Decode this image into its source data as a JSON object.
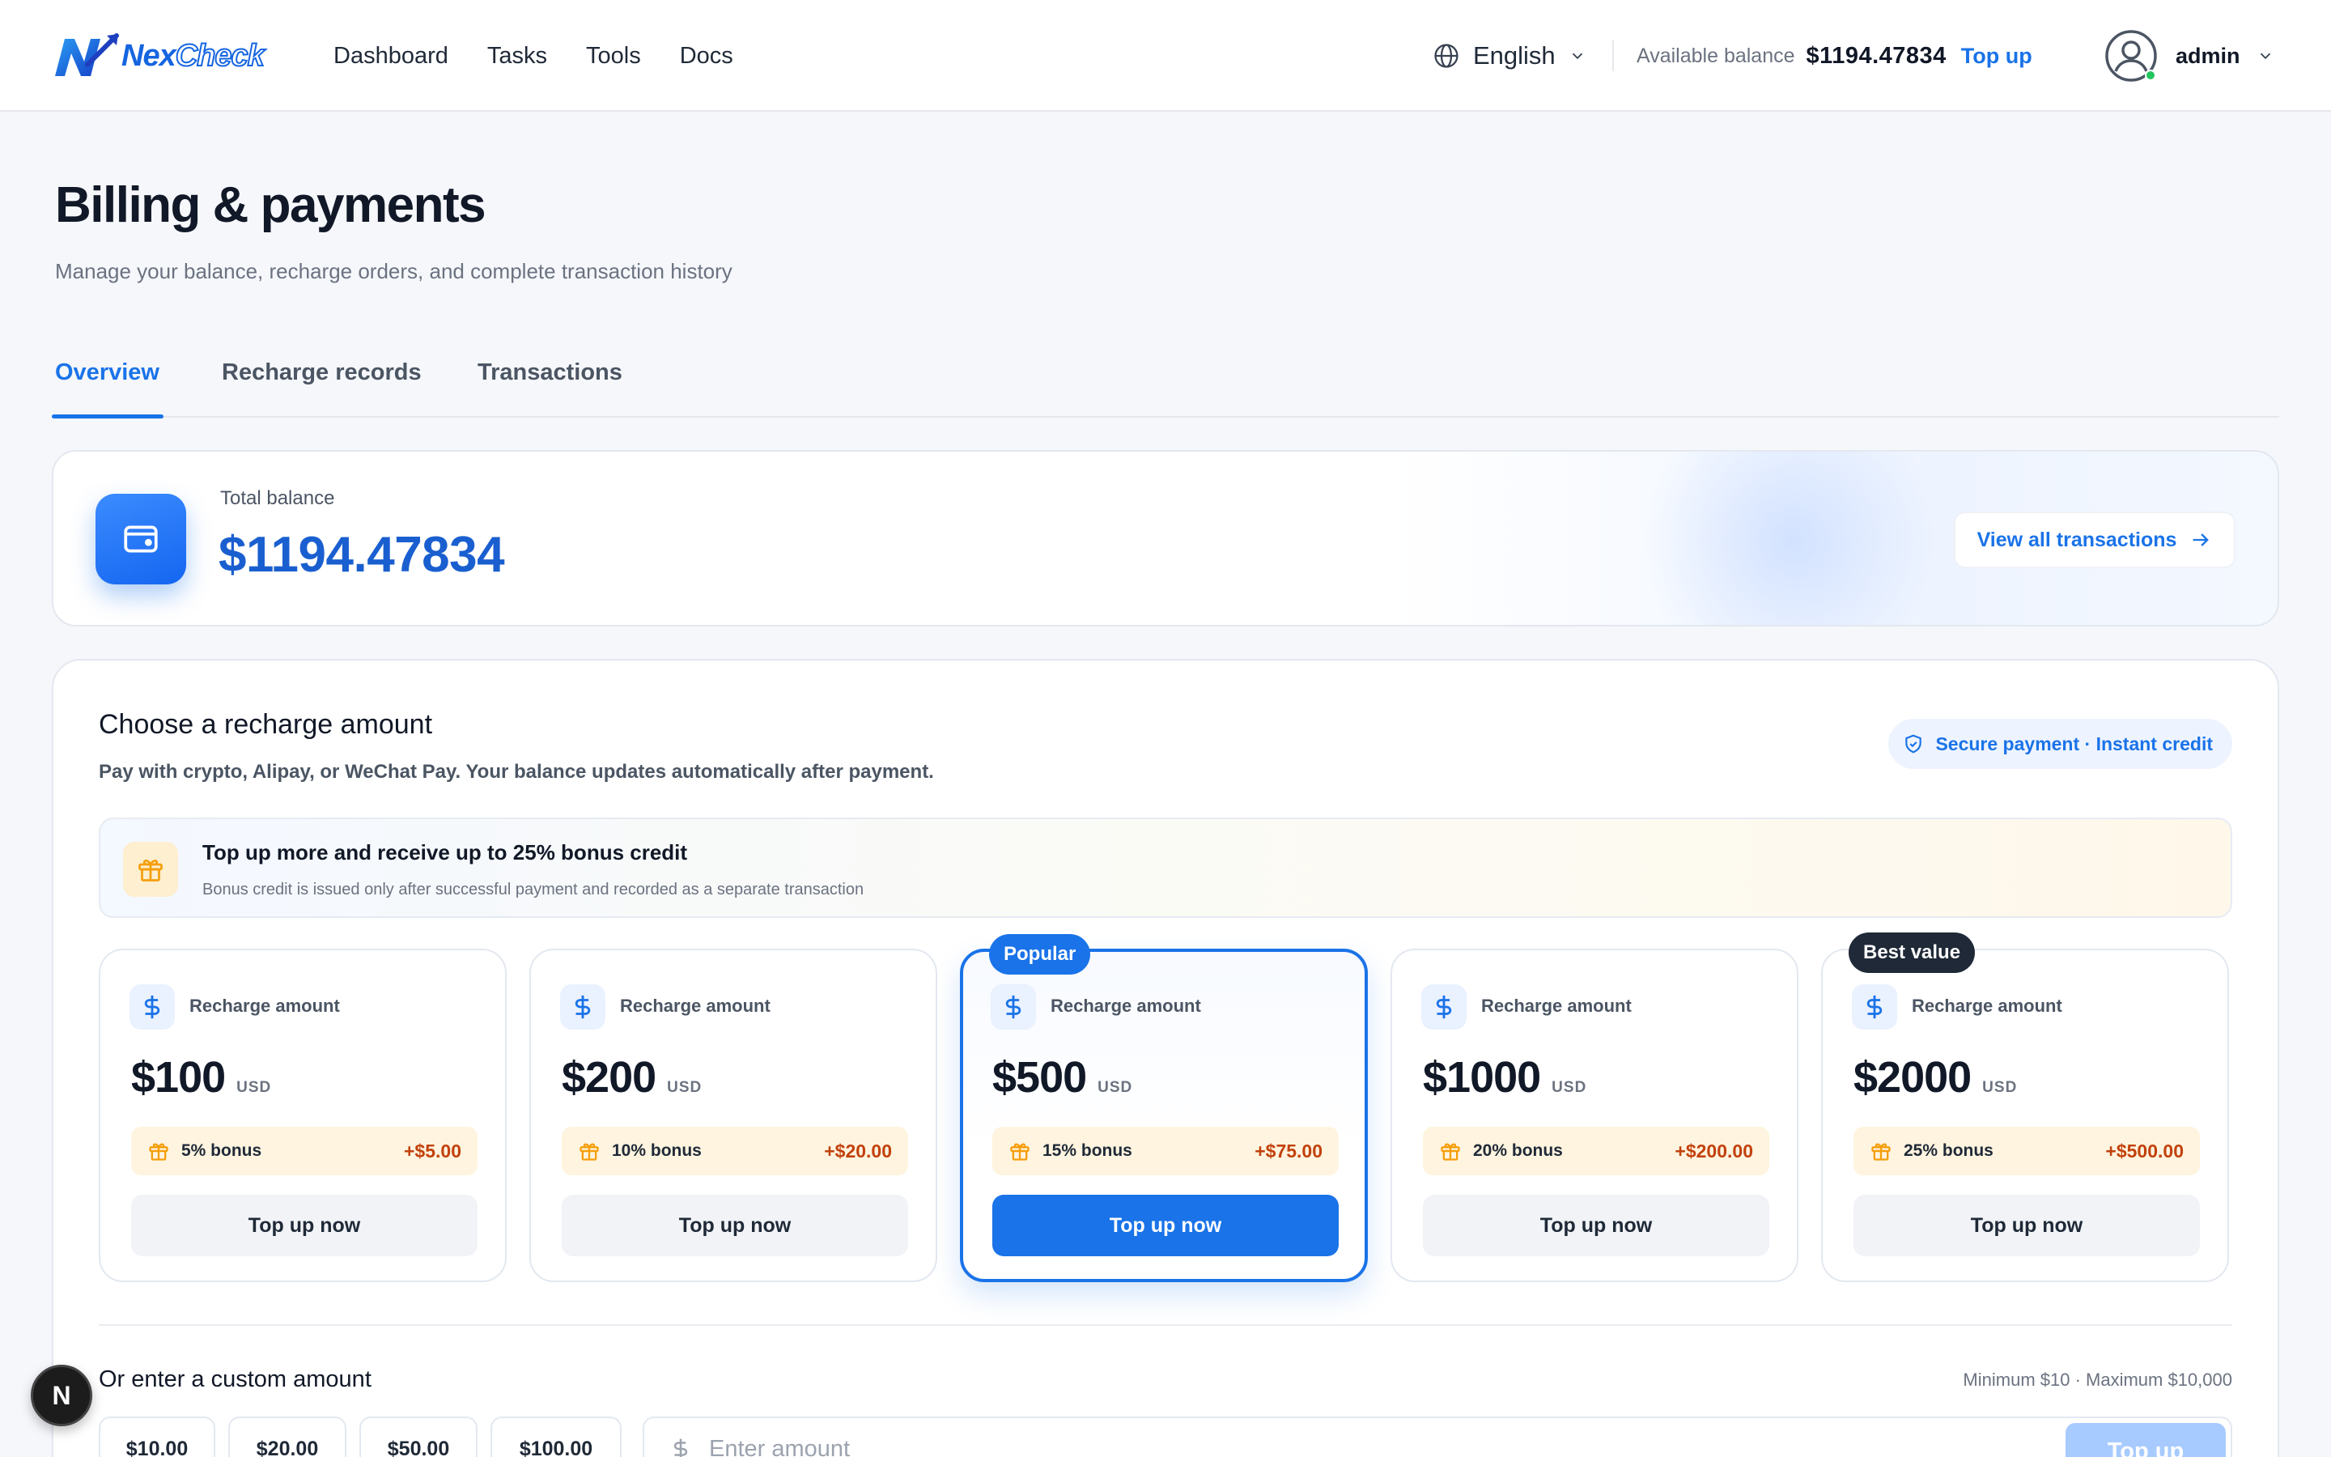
{
  "header": {
    "logo": {
      "part1": "Nex",
      "part2": "Check"
    },
    "nav": [
      "Dashboard",
      "Tasks",
      "Tools",
      "Docs"
    ],
    "language": "English",
    "balance_label": "Available balance",
    "balance_amount": "$1194.47834",
    "topup_label": "Top up",
    "username": "admin"
  },
  "page": {
    "title": "Billing & payments",
    "subtitle": "Manage your balance, recharge orders, and complete transaction history"
  },
  "tabs": [
    {
      "label": "Overview",
      "active": true
    },
    {
      "label": "Recharge records",
      "active": false
    },
    {
      "label": "Transactions",
      "active": false
    }
  ],
  "balance_card": {
    "label": "Total balance",
    "amount": "$1194.47834",
    "view_all": "View all transactions"
  },
  "recharge": {
    "title": "Choose a recharge amount",
    "subtitle": "Pay with crypto, Alipay, or WeChat Pay. Your balance updates automatically after payment.",
    "secure": "Secure payment · Instant credit",
    "banner": {
      "title": "Top up more and receive up to 25% bonus credit",
      "subtitle": "Bonus credit is issued only after successful payment and recorded as a separate transaction"
    },
    "plans": [
      {
        "label": "Recharge amount",
        "amount": "$100",
        "unit": "USD",
        "bonus_label": "5% bonus",
        "bonus_amount": "+$5.00",
        "button": "Top up now",
        "tag": ""
      },
      {
        "label": "Recharge amount",
        "amount": "$200",
        "unit": "USD",
        "bonus_label": "10% bonus",
        "bonus_amount": "+$20.00",
        "button": "Top up now",
        "tag": ""
      },
      {
        "label": "Recharge amount",
        "amount": "$500",
        "unit": "USD",
        "bonus_label": "15% bonus",
        "bonus_amount": "+$75.00",
        "button": "Top up now",
        "tag": "Popular"
      },
      {
        "label": "Recharge amount",
        "amount": "$1000",
        "unit": "USD",
        "bonus_label": "20% bonus",
        "bonus_amount": "+$200.00",
        "button": "Top up now",
        "tag": ""
      },
      {
        "label": "Recharge amount",
        "amount": "$2000",
        "unit": "USD",
        "bonus_label": "25% bonus",
        "bonus_amount": "+$500.00",
        "button": "Top up now",
        "tag": "Best value"
      }
    ],
    "custom": {
      "title": "Or enter a custom amount",
      "limits": "Minimum $10 · Maximum $10,000",
      "presets": [
        "$10.00",
        "$20.00",
        "$50.00",
        "$100.00"
      ],
      "placeholder": "Enter amount",
      "button": "Top up"
    }
  },
  "fab": "N",
  "colors": {
    "accent": "#1a73e8",
    "bonus_text": "#c2410c",
    "dark_tag": "#1f2937"
  }
}
